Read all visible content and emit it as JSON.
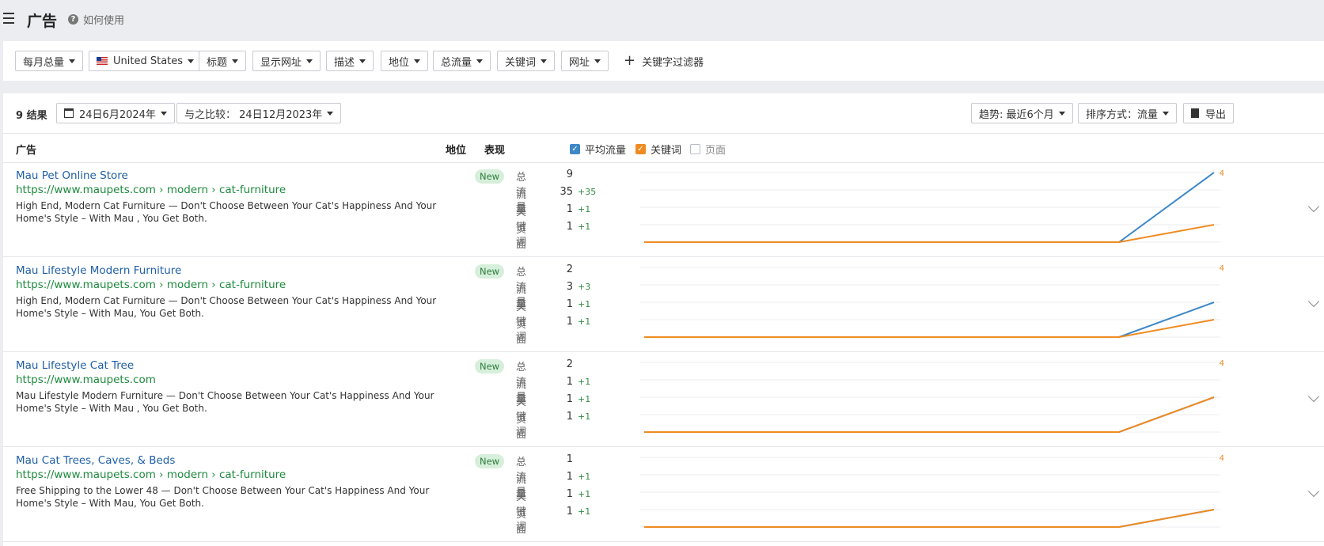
{
  "header": {
    "title": "广告",
    "help_label": "如何使用"
  },
  "filters": {
    "monthly_volume": "每月总量",
    "country": "United States",
    "title": "标题",
    "display_url": "显示网址",
    "description": "描述",
    "position": "地位",
    "total_traffic": "总流量",
    "keywords": "关键词",
    "url": "网址",
    "keyword_filter": "关键字过滤器"
  },
  "toolbar": {
    "results": "9 结果",
    "date": "24日6月2024年",
    "compare": "与之比较：  24日12月2023年",
    "trend": "趋势: 最近6个月",
    "sort": "排序方式：流量",
    "export": "导出"
  },
  "columns": {
    "ad": "广告",
    "position": "地位",
    "performance": "表现",
    "legend_avg_traffic": "平均流量",
    "legend_keywords": "关键词",
    "legend_pages": "页面"
  },
  "colors": {
    "avg_traffic": "#3d88c7",
    "keywords": "#ef8b21",
    "badge_bg": "#d6efdb",
    "link": "#1f5fa8",
    "url": "#1e8a3e"
  },
  "metric_labels": {
    "total": "总流量",
    "traffic": "流量",
    "keywords": "关键词",
    "pages": "页面"
  },
  "rows": [
    {
      "title": "Mau Pet Online Store",
      "url": "https://www.maupets.com › modern › cat-furniture",
      "desc": "High End, Modern Cat Furniture — Don't Choose Between Your Cat's Happiness And Your Home's Style – With Mau , You Get Both.",
      "badge": "New",
      "total": "9",
      "traffic": "35",
      "traffic_delta": "+35",
      "keywords": "1",
      "keywords_delta": "+1",
      "pages": "1",
      "pages_delta": "+1",
      "left_max": "12",
      "right_max": "4",
      "traffic_series": [
        0,
        0,
        0,
        0,
        0,
        0,
        35
      ],
      "keyword_series": [
        0,
        0,
        0,
        0,
        0,
        0,
        1
      ],
      "traffic_scale": 12,
      "keyword_scale": 4
    },
    {
      "title": "Mau Lifestyle Modern Furniture",
      "url": "https://www.maupets.com › modern › cat-furniture",
      "desc": "High End, Modern Cat Furniture — Don't Choose Between Your Cat's Happiness And Your Home's Style – With Mau, You Get Both.",
      "badge": "New",
      "total": "2",
      "traffic": "3",
      "traffic_delta": "+3",
      "keywords": "1",
      "keywords_delta": "+1",
      "pages": "1",
      "pages_delta": "+1",
      "left_max": "4",
      "right_max": "4",
      "traffic_series": [
        0,
        0,
        0,
        0,
        0,
        0,
        2
      ],
      "keyword_series": [
        0,
        0,
        0,
        0,
        0,
        0,
        1
      ],
      "traffic_scale": 4,
      "keyword_scale": 4
    },
    {
      "title": "Mau Lifestyle Cat Tree",
      "url": "https://www.maupets.com",
      "desc": "Mau Lifestyle Modern Furniture — Don't Choose Between Your Cat's Happiness And Your Home's Style – With Mau , You Get Both.",
      "badge": "New",
      "total": "2",
      "traffic": "1",
      "traffic_delta": "+1",
      "keywords": "1",
      "keywords_delta": "+1",
      "pages": "1",
      "pages_delta": "+1",
      "left_max": "4",
      "right_max": "4",
      "traffic_series": [
        0,
        0,
        0,
        0,
        0,
        0,
        2
      ],
      "keyword_series": [
        0,
        0,
        0,
        0,
        0,
        0,
        2
      ],
      "traffic_scale": 4,
      "keyword_scale": 4
    },
    {
      "title": "Mau Cat Trees, Caves, & Beds",
      "url": "https://www.maupets.com › modern › cat-furniture",
      "desc": "Free Shipping to the Lower 48 — Don't Choose Between Your Cat's Happiness And Your Home's Style – With Mau, You Get Both.",
      "badge": "New",
      "total": "1",
      "traffic": "1",
      "traffic_delta": "+1",
      "keywords": "1",
      "keywords_delta": "+1",
      "pages": "1",
      "pages_delta": "+1",
      "left_max": "4",
      "right_max": "4",
      "traffic_series": [
        0,
        0,
        0,
        0,
        0,
        0,
        1
      ],
      "keyword_series": [
        0,
        0,
        0,
        0,
        0,
        0,
        1
      ],
      "traffic_scale": 4,
      "keyword_scale": 4
    }
  ]
}
